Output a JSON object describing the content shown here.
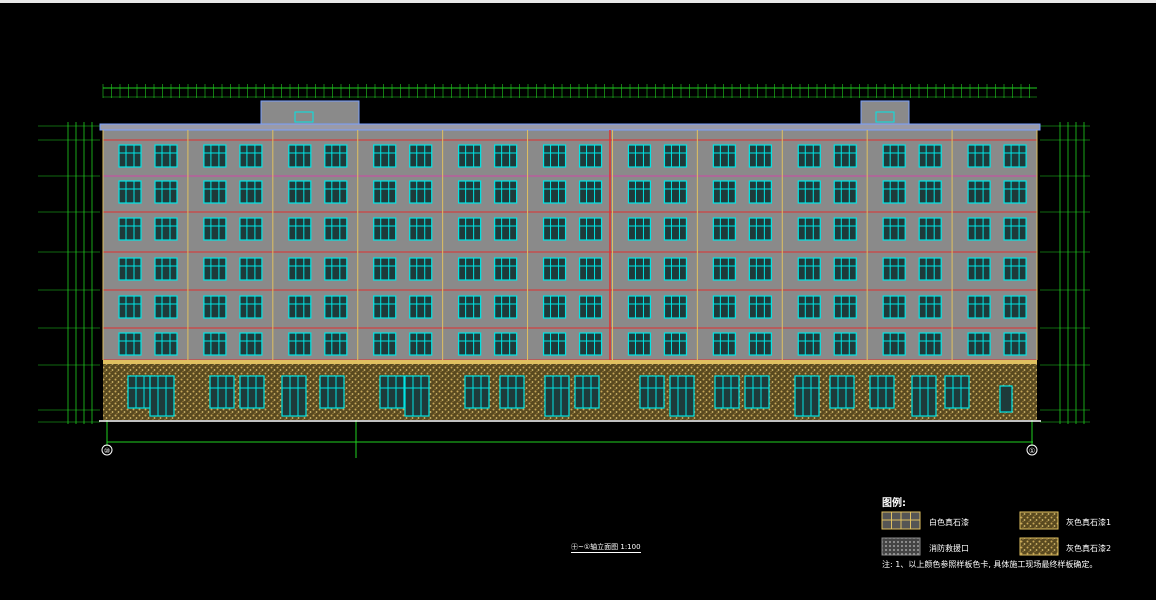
{
  "colors": {
    "background": "#000000",
    "wall": "#8a8a8a",
    "window_frame": "#00e5e5",
    "trim_yellow": "#e0c060",
    "floor_line_red": "#e03030",
    "dimension_green": "#20d020",
    "stone": "#b89a50",
    "outline_blue": "#7aa0ff"
  },
  "legend": {
    "title": "图例:",
    "items": [
      {
        "label": "白色真石漆",
        "icon": "grid-swatch-icon"
      },
      {
        "label": "灰色真石漆1",
        "icon": "stone-swatch-icon"
      },
      {
        "label": "消防救援口",
        "icon": "dotted-swatch-icon"
      },
      {
        "label": "灰色真石漆2",
        "icon": "stone-swatch-icon"
      }
    ],
    "note": "注: 1、以上颜色参照样板色卡, 具体施工现场最终样板确定。"
  },
  "caption": "㊉~①轴立面图 1:100",
  "axis": {
    "left": "⑩",
    "right": "①"
  }
}
